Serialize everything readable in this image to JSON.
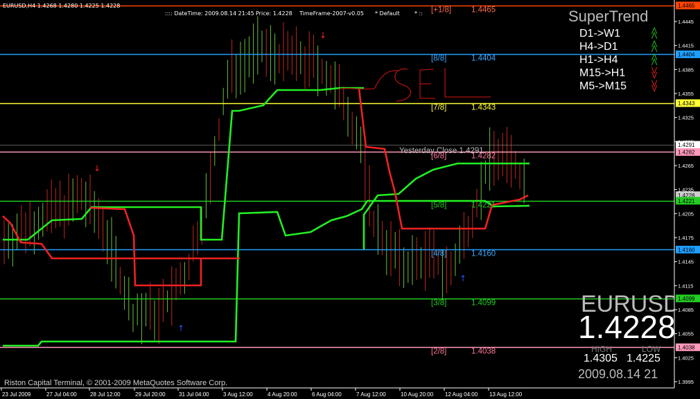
{
  "window": {
    "symbol_info": "EURUSD,H4  1.4268 1.4280 1.4225 1.4228"
  },
  "header_info": {
    "datetime": ":::: DateTime: 2009.08.14 21:45",
    "price": "Price: 1.4228",
    "timeframe": "TimeFrame-2007-v0.05",
    "default_label": "* Default",
    "extra": "* ::"
  },
  "murrey_levels": [
    {
      "label": "[+1/8]",
      "value": "1.4465",
      "price": 1.4465,
      "color": "#ff4500",
      "label_color": "#ff6a4d"
    },
    {
      "label": "[8/8]",
      "value": "1.4404",
      "price": 1.4404,
      "color": "#1e9fff",
      "label_color": "#3aa8ff"
    },
    {
      "label": "[7/8]",
      "value": "1.4343",
      "price": 1.4343,
      "color": "#ffff33",
      "label_color": "#ffff33"
    },
    {
      "label": "[6/8]",
      "value": "1.4282",
      "price": 1.4282,
      "color": "#ff99bb",
      "label_color": "#ff7799"
    },
    {
      "label": "[5/8]",
      "value": "1.4221",
      "price": 1.4221,
      "color": "#22cc22",
      "label_color": "#22cc22"
    },
    {
      "label": "[4/8]",
      "value": "1.4160",
      "price": 1.416,
      "color": "#1e9fff",
      "label_color": "#3aa8ff"
    },
    {
      "label": "[3/8]",
      "value": "1.4099",
      "price": 1.4099,
      "color": "#22cc22",
      "label_color": "#22cc22"
    },
    {
      "label": "[2/8]",
      "value": "1.4038",
      "price": 1.4038,
      "color": "#ff99bb",
      "label_color": "#ff7799"
    }
  ],
  "yesterday_close": {
    "label": "Yesterday Close 1.4291",
    "price": 1.4291,
    "tag": "1.4291"
  },
  "price_axis": {
    "ticks": [
      "1.4445",
      "1.4415",
      "1.4385",
      "1.4355",
      "1.4325",
      "1.4295",
      "1.4265",
      "1.4235",
      "1.4205",
      "1.4175",
      "1.4145",
      "1.4115",
      "1.4085",
      "1.4055",
      "1.4025",
      "1.3995"
    ],
    "tags": [
      {
        "text": "1.4465",
        "price": 1.4465,
        "bg": "#ff4500",
        "fg": "#000"
      },
      {
        "text": "1.4404",
        "price": 1.4404,
        "bg": "#1e9fff",
        "fg": "#000"
      },
      {
        "text": "1.4343",
        "price": 1.4343,
        "bg": "#ffff33",
        "fg": "#000"
      },
      {
        "text": "1.4291",
        "price": 1.4291,
        "bg": "#ffffff",
        "fg": "#000"
      },
      {
        "text": "1.4282",
        "price": 1.4282,
        "bg": "#ff99bb",
        "fg": "#000"
      },
      {
        "text": "1.4228",
        "price": 1.4228,
        "bg": "#cccccc",
        "fg": "#000"
      },
      {
        "text": "1.4221",
        "price": 1.4221,
        "bg": "#22cc22",
        "fg": "#000"
      },
      {
        "text": "1.4160",
        "price": 1.416,
        "bg": "#1e9fff",
        "fg": "#000"
      },
      {
        "text": "1.4099",
        "price": 1.4099,
        "bg": "#22cc22",
        "fg": "#000"
      },
      {
        "text": "1.4038",
        "price": 1.4038,
        "bg": "#ff99bb",
        "fg": "#000"
      }
    ]
  },
  "time_axis": [
    "23 Jul 2009",
    "27 Jul 04:00",
    "28 Jul 12:00",
    "29 Jul 20:00",
    "31 Jul 04:00",
    "3 Aug 12:00",
    "4 Aug 20:00",
    "6 Aug 04:00",
    "7 Aug 12:00",
    "10 Aug 20:00",
    "12 Aug 04:00",
    "13 Aug 12:00"
  ],
  "supertrend": {
    "title": "SuperTrend",
    "rows": [
      {
        "label": "D1->W1",
        "signal": "up",
        "color": "#22cc22"
      },
      {
        "label": "H4->D1",
        "signal": "up",
        "color": "#22cc22"
      },
      {
        "label": "H1->H4",
        "signal": "up",
        "color": "#22cc22"
      },
      {
        "label": "M15->H1",
        "signal": "down",
        "color": "#ff2222"
      },
      {
        "label": "M5->M15",
        "signal": "down",
        "color": "#ff2222"
      }
    ]
  },
  "price_panel": {
    "symbol": "EURUSD",
    "price": "1.4228",
    "high_label": "HIGH",
    "low_label": "LOW",
    "high": "1.4305",
    "low": "1.4225",
    "datetime": "2009.08.14 21"
  },
  "annotation": {
    "text": "SEL"
  },
  "copyright": "Riston Capital Terminal, © 2001-2009 MetaQuotes Software Corp."
}
